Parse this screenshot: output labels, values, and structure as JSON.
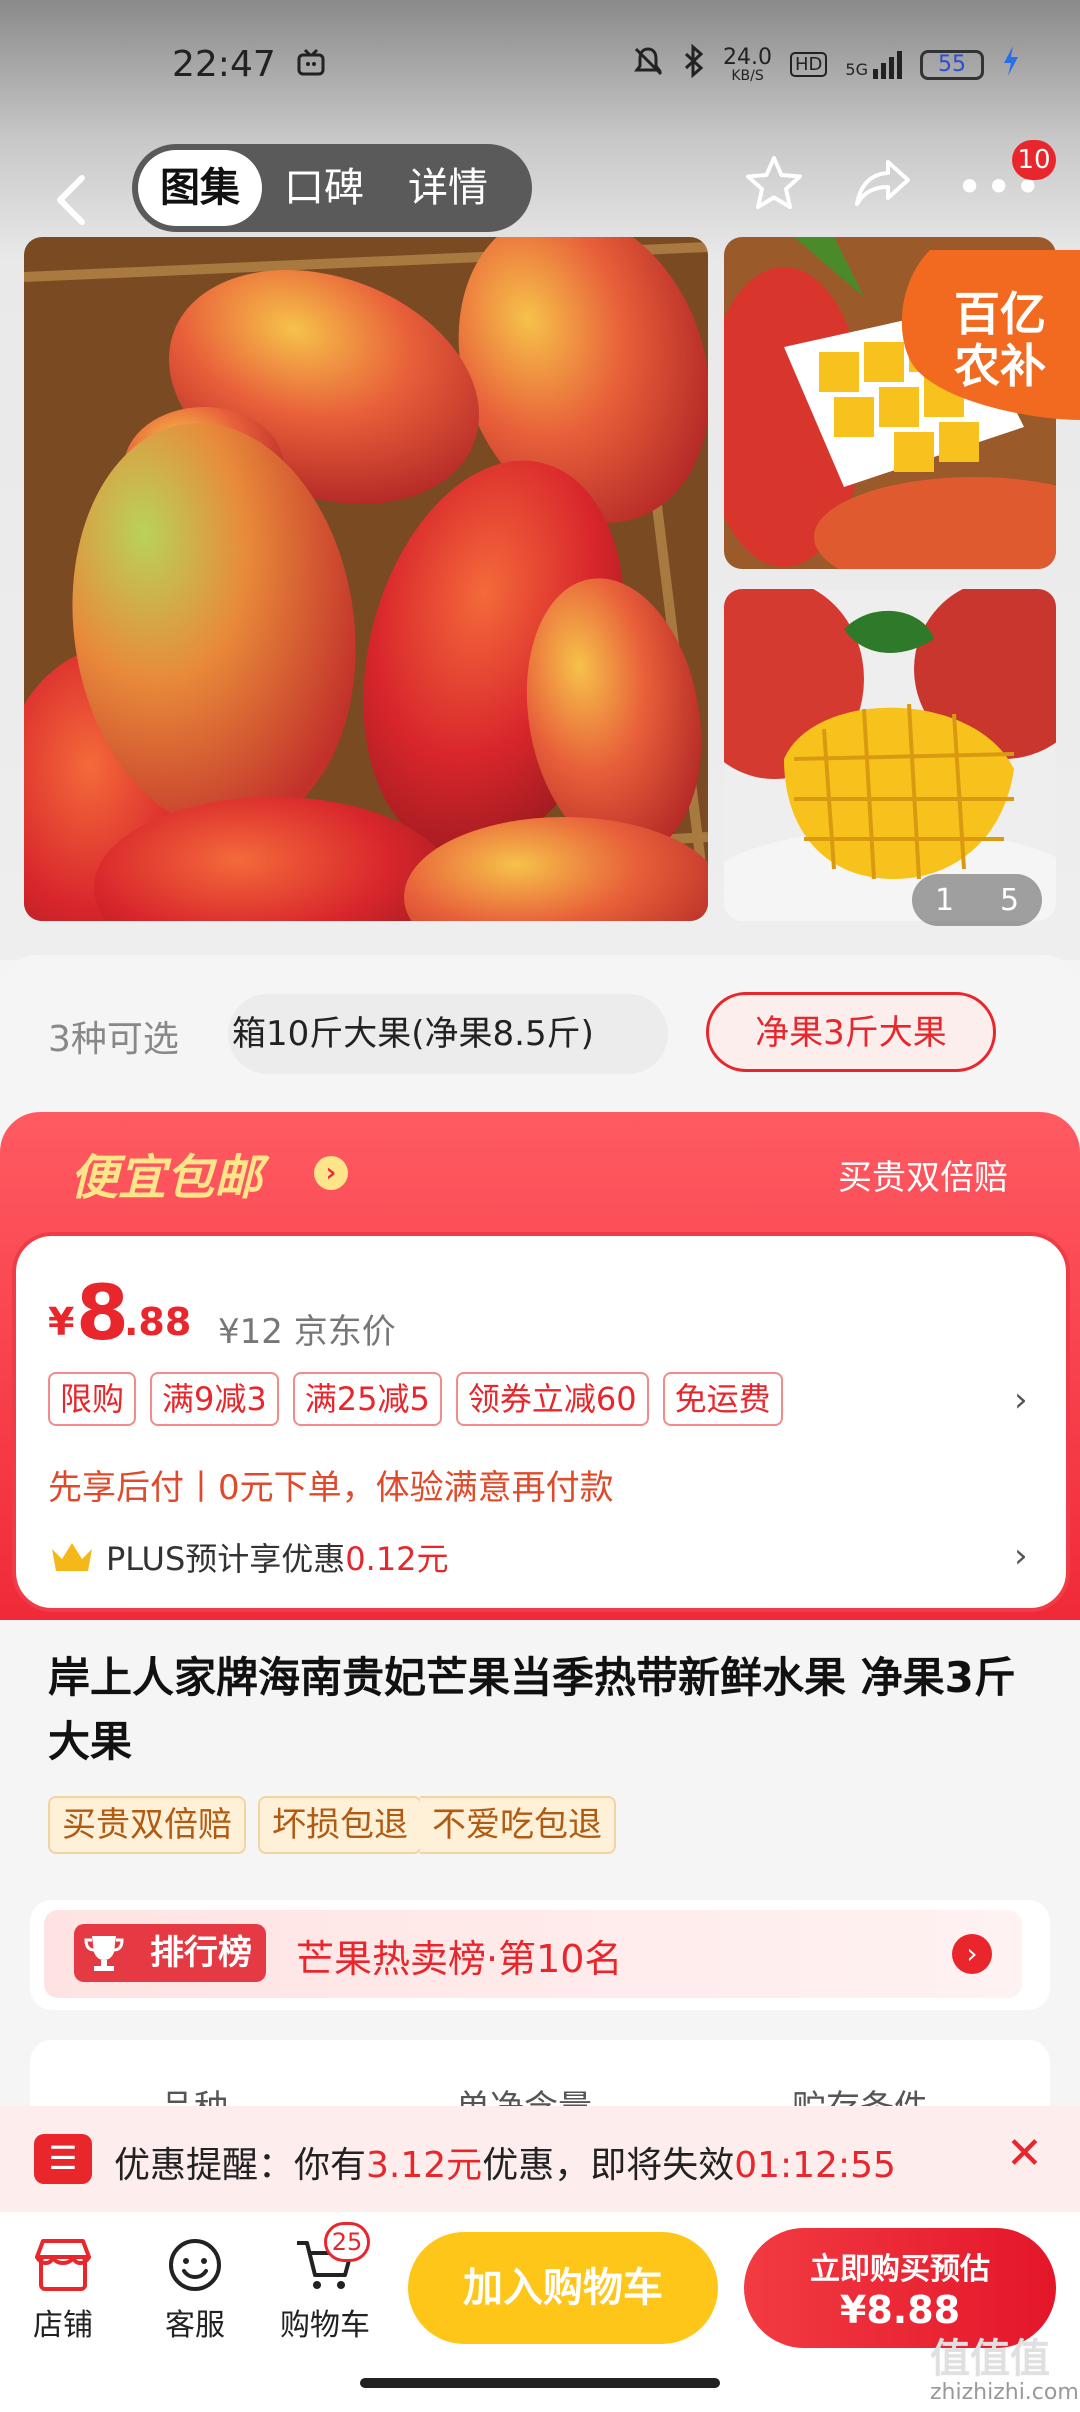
{
  "status_bar": {
    "time": "22:47",
    "net_speed_top": "24.0",
    "net_speed_unit": "KB/S",
    "hd": "HD",
    "net": "5G",
    "battery": "55"
  },
  "nav": {
    "tabs": [
      "图集",
      "口碑",
      "详情"
    ],
    "badge": "10"
  },
  "gallery": {
    "corner_badge": [
      "百亿",
      "农补"
    ],
    "counter_current": "1",
    "counter_total": "5"
  },
  "variants": {
    "count_label": "3种可选",
    "option1": "箱10斤大果(净果8.5斤)",
    "option2": "净果3斤大果"
  },
  "promo": {
    "title": "便宜包邮",
    "right": "买贵双倍赔"
  },
  "price": {
    "symbol": "¥",
    "integer": "8",
    "decimal": ".88",
    "original": "¥12 京东价",
    "tags": [
      "限购",
      "满9减3",
      "满25减5",
      "领券立减60",
      "免运费"
    ],
    "bnpl": "先享后付丨0元下单，体验满意再付款",
    "plus_label": "PLUS预计享优惠",
    "plus_value": "0.12元"
  },
  "product": {
    "title": "岸上人家牌海南贵妃芒果当季热带新鲜水果 净果3斤大果",
    "service_tags": [
      "买贵双倍赔",
      "坏损包退",
      "不爱吃包退"
    ]
  },
  "rank": {
    "tag": "排行榜",
    "text": "芒果热卖榜·第10名"
  },
  "specs": [
    "品种",
    "单净含量",
    "贮存条件"
  ],
  "notice": {
    "prefix": "优惠提醒：你有",
    "amount": "3.12元",
    "middle": "优惠，即将失效",
    "countdown": "01:12:55"
  },
  "bottom": {
    "store": "店铺",
    "service": "客服",
    "cart": "购物车",
    "cart_count": "25",
    "add_cart": "加入购物车",
    "buy_line1": "立即购买预估",
    "buy_line2": "¥8.88"
  },
  "watermark": {
    "main": "值值值",
    "sub": "zhizhizhi.com"
  },
  "colors": {
    "brand_red": "#e8262b",
    "yellow": "#ffc61a"
  }
}
